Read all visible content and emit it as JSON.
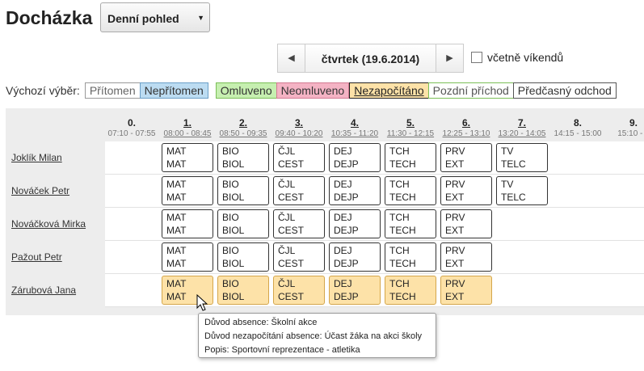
{
  "header": {
    "title": "Docházka",
    "view_select": "Denní pohled"
  },
  "date_nav": {
    "prev_icon": "◀",
    "date": "čtvrtek (19.6.2014)",
    "next_icon": "▶"
  },
  "weekend": {
    "label": "včetně víkendů",
    "checked": false
  },
  "legend": {
    "label": "Výchozí výběr:",
    "items": [
      {
        "label": "Přítomen",
        "bg": "#ffffff",
        "border": "#999999",
        "color": "#666666"
      },
      {
        "label": "Nepřítomen",
        "bg": "#bcdcf2",
        "border": "#6b9fc7",
        "color": "#333333"
      },
      {
        "label": "Omluveno",
        "bg": "#c6efb0",
        "border": "#7bbf57",
        "color": "#333333"
      },
      {
        "label": "Neomluveno",
        "bg": "#f4b3c4",
        "border": "#d27a92",
        "color": "#333333"
      },
      {
        "label": "Nezapočítáno",
        "bg": "#fde2a8",
        "border": "#222222",
        "color": "#222222"
      },
      {
        "label": "Pozdní příchod",
        "bg": "#ffffff",
        "border": "#7bbf57",
        "color": "#555555"
      },
      {
        "label": "Předčasný odchod",
        "bg": "#ffffff",
        "border": "#555555",
        "color": "#333333"
      }
    ]
  },
  "periods": [
    {
      "num": "0.",
      "time": "07:10 - 07:55",
      "underline": false
    },
    {
      "num": "1.",
      "time": "08:00 - 08:45",
      "underline": true
    },
    {
      "num": "2.",
      "time": "08:50 - 09:35",
      "underline": true
    },
    {
      "num": "3.",
      "time": "09:40 - 10:20",
      "underline": true
    },
    {
      "num": "4.",
      "time": "10:35 - 11:20",
      "underline": true
    },
    {
      "num": "5.",
      "time": "11:30 - 12:15",
      "underline": true
    },
    {
      "num": "6.",
      "time": "12:25 - 13:10",
      "underline": true
    },
    {
      "num": "7.",
      "time": "13:20 - 14:05",
      "underline": true
    },
    {
      "num": "8.",
      "time": "14:15 - 15:00",
      "underline": false
    },
    {
      "num": "9.",
      "time": "15:10 - 1",
      "underline": false
    }
  ],
  "students": [
    {
      "name": "Joklík Milan",
      "lessons": [
        {
          "period": 1,
          "s": "MAT",
          "g": "MAT"
        },
        {
          "period": 2,
          "s": "BIO",
          "g": "BIOL"
        },
        {
          "period": 3,
          "s": "ČJL",
          "g": "CEST"
        },
        {
          "period": 4,
          "s": "DEJ",
          "g": "DEJP"
        },
        {
          "period": 5,
          "s": "TCH",
          "g": "TECH"
        },
        {
          "period": 6,
          "s": "PRV",
          "g": "EXT"
        },
        {
          "period": 7,
          "s": "TV",
          "g": "TELC"
        }
      ]
    },
    {
      "name": "Nováček Petr",
      "lessons": [
        {
          "period": 1,
          "s": "MAT",
          "g": "MAT"
        },
        {
          "period": 2,
          "s": "BIO",
          "g": "BIOL"
        },
        {
          "period": 3,
          "s": "ČJL",
          "g": "CEST"
        },
        {
          "period": 4,
          "s": "DEJ",
          "g": "DEJP"
        },
        {
          "period": 5,
          "s": "TCH",
          "g": "TECH"
        },
        {
          "period": 6,
          "s": "PRV",
          "g": "EXT"
        },
        {
          "period": 7,
          "s": "TV",
          "g": "TELC"
        }
      ]
    },
    {
      "name": "Nováčková Mirka",
      "lessons": [
        {
          "period": 1,
          "s": "MAT",
          "g": "MAT"
        },
        {
          "period": 2,
          "s": "BIO",
          "g": "BIOL"
        },
        {
          "period": 3,
          "s": "ČJL",
          "g": "CEST"
        },
        {
          "period": 4,
          "s": "DEJ",
          "g": "DEJP"
        },
        {
          "period": 5,
          "s": "TCH",
          "g": "TECH"
        },
        {
          "period": 6,
          "s": "PRV",
          "g": "EXT"
        }
      ]
    },
    {
      "name": "Pažout Petr",
      "lessons": [
        {
          "period": 1,
          "s": "MAT",
          "g": "MAT"
        },
        {
          "period": 2,
          "s": "BIO",
          "g": "BIOL"
        },
        {
          "period": 3,
          "s": "ČJL",
          "g": "CEST"
        },
        {
          "period": 4,
          "s": "DEJ",
          "g": "DEJP"
        },
        {
          "period": 5,
          "s": "TCH",
          "g": "TECH"
        },
        {
          "period": 6,
          "s": "PRV",
          "g": "EXT"
        }
      ]
    },
    {
      "name": "Zárubová Jana",
      "lessons": [
        {
          "period": 1,
          "s": "MAT",
          "g": "MAT",
          "nz": true
        },
        {
          "period": 2,
          "s": "BIO",
          "g": "BIOL",
          "nz": true
        },
        {
          "period": 3,
          "s": "ČJL",
          "g": "CEST",
          "nz": true
        },
        {
          "period": 4,
          "s": "DEJ",
          "g": "DEJP",
          "nz": true
        },
        {
          "period": 5,
          "s": "TCH",
          "g": "TECH",
          "nz": true
        },
        {
          "period": 6,
          "s": "PRV",
          "g": "EXT",
          "nz": true
        }
      ]
    }
  ],
  "tooltip": {
    "line1": "Důvod absence: Školní akce",
    "line2": "Důvod nezapočítání absence: Účast žáka na akci školy",
    "line3": "Popis: Sportovní reprezentace - atletika"
  }
}
